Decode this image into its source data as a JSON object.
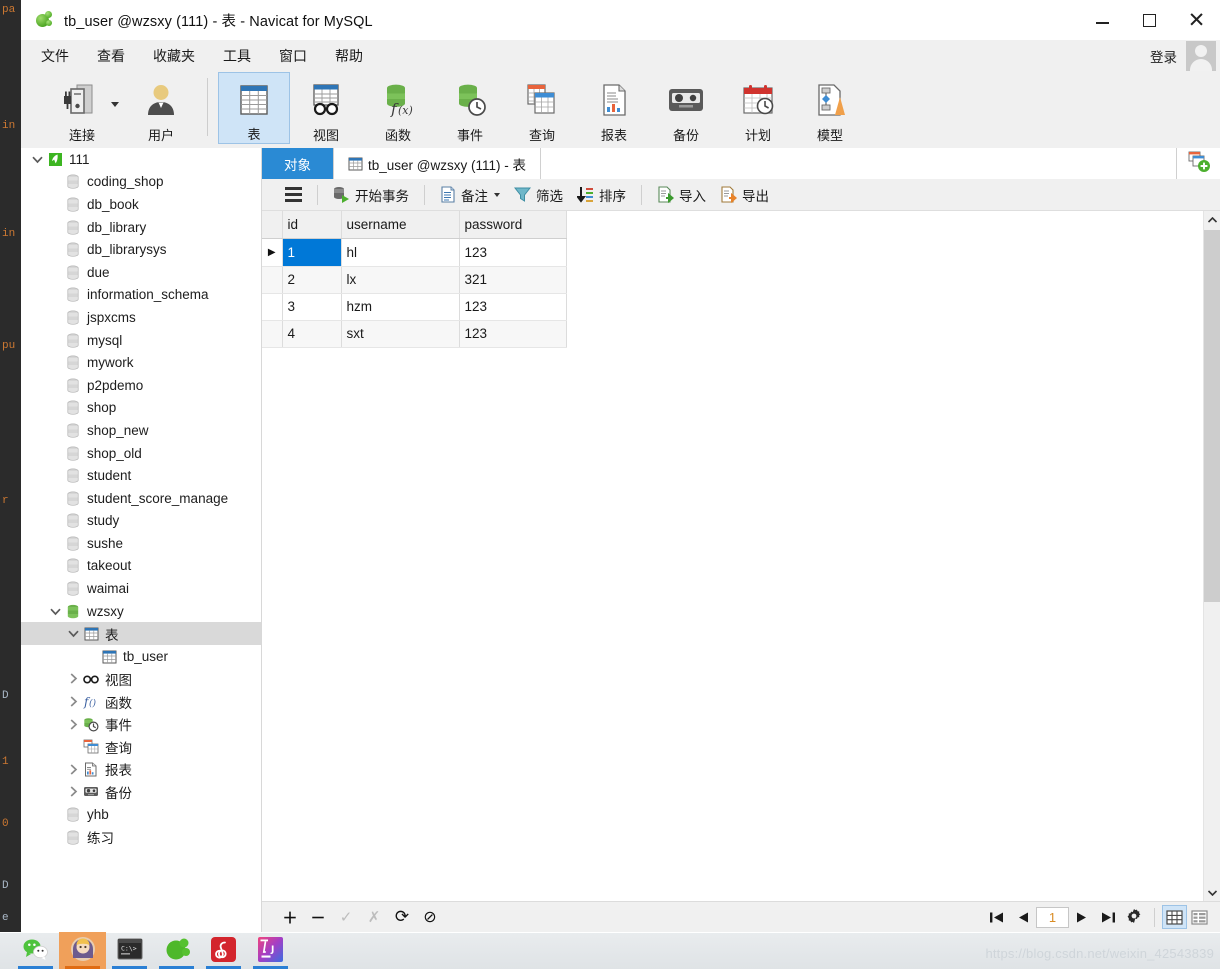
{
  "window": {
    "title": "tb_user @wzsxy (111) - 表 - Navicat for MySQL",
    "app_icon": "navicat-elephant-icon",
    "minimize_label": "",
    "maximize_label": "",
    "close_label": "✕"
  },
  "menubar": {
    "items": [
      {
        "label": "文件",
        "name": "menu-file"
      },
      {
        "label": "查看",
        "name": "menu-view"
      },
      {
        "label": "收藏夹",
        "name": "menu-favorites"
      },
      {
        "label": "工具",
        "name": "menu-tools"
      },
      {
        "label": "窗口",
        "name": "menu-window"
      },
      {
        "label": "帮助",
        "name": "menu-help"
      }
    ],
    "login_label": "登录"
  },
  "toolbar": {
    "items": [
      {
        "label": "连接",
        "icon": "connection-icon",
        "has_dropdown": true,
        "active": false
      },
      {
        "label": "用户",
        "icon": "user-icon",
        "has_dropdown": false,
        "active": false
      },
      {
        "label": "表",
        "icon": "table-icon",
        "has_dropdown": false,
        "active": true
      },
      {
        "label": "视图",
        "icon": "view-icon",
        "has_dropdown": false,
        "active": false
      },
      {
        "label": "函数",
        "icon": "function-icon",
        "has_dropdown": false,
        "active": false
      },
      {
        "label": "事件",
        "icon": "event-icon",
        "has_dropdown": false,
        "active": false
      },
      {
        "label": "查询",
        "icon": "query-icon",
        "has_dropdown": false,
        "active": false
      },
      {
        "label": "报表",
        "icon": "report-icon",
        "has_dropdown": false,
        "active": false
      },
      {
        "label": "备份",
        "icon": "backup-icon",
        "has_dropdown": false,
        "active": false
      },
      {
        "label": "计划",
        "icon": "schedule-icon",
        "has_dropdown": false,
        "active": false
      },
      {
        "label": "模型",
        "icon": "model-icon",
        "has_dropdown": false,
        "active": false
      }
    ]
  },
  "sidebar": {
    "items": [
      {
        "label": "111",
        "indent": 0,
        "icon": "connection-green-icon",
        "twisty": "down",
        "selected": false
      },
      {
        "label": "coding_shop",
        "indent": 1,
        "icon": "database-gray-icon",
        "twisty": "none",
        "selected": false
      },
      {
        "label": "db_book",
        "indent": 1,
        "icon": "database-gray-icon",
        "twisty": "none",
        "selected": false
      },
      {
        "label": "db_library",
        "indent": 1,
        "icon": "database-gray-icon",
        "twisty": "none",
        "selected": false
      },
      {
        "label": "db_librarysys",
        "indent": 1,
        "icon": "database-gray-icon",
        "twisty": "none",
        "selected": false
      },
      {
        "label": "due",
        "indent": 1,
        "icon": "database-gray-icon",
        "twisty": "none",
        "selected": false
      },
      {
        "label": "information_schema",
        "indent": 1,
        "icon": "database-gray-icon",
        "twisty": "none",
        "selected": false
      },
      {
        "label": "jspxcms",
        "indent": 1,
        "icon": "database-gray-icon",
        "twisty": "none",
        "selected": false
      },
      {
        "label": "mysql",
        "indent": 1,
        "icon": "database-gray-icon",
        "twisty": "none",
        "selected": false
      },
      {
        "label": "mywork",
        "indent": 1,
        "icon": "database-gray-icon",
        "twisty": "none",
        "selected": false
      },
      {
        "label": "p2pdemo",
        "indent": 1,
        "icon": "database-gray-icon",
        "twisty": "none",
        "selected": false
      },
      {
        "label": "shop",
        "indent": 1,
        "icon": "database-gray-icon",
        "twisty": "none",
        "selected": false
      },
      {
        "label": "shop_new",
        "indent": 1,
        "icon": "database-gray-icon",
        "twisty": "none",
        "selected": false
      },
      {
        "label": "shop_old",
        "indent": 1,
        "icon": "database-gray-icon",
        "twisty": "none",
        "selected": false
      },
      {
        "label": "student",
        "indent": 1,
        "icon": "database-gray-icon",
        "twisty": "none",
        "selected": false
      },
      {
        "label": "student_score_manage",
        "indent": 1,
        "icon": "database-gray-icon",
        "twisty": "none",
        "selected": false
      },
      {
        "label": "study",
        "indent": 1,
        "icon": "database-gray-icon",
        "twisty": "none",
        "selected": false
      },
      {
        "label": "sushe",
        "indent": 1,
        "icon": "database-gray-icon",
        "twisty": "none",
        "selected": false
      },
      {
        "label": "takeout",
        "indent": 1,
        "icon": "database-gray-icon",
        "twisty": "none",
        "selected": false
      },
      {
        "label": "waimai",
        "indent": 1,
        "icon": "database-gray-icon",
        "twisty": "none",
        "selected": false
      },
      {
        "label": "wzsxy",
        "indent": 1,
        "icon": "database-green-icon",
        "twisty": "down",
        "selected": false
      },
      {
        "label": "表",
        "indent": 2,
        "icon": "table-icon",
        "twisty": "down",
        "selected": true
      },
      {
        "label": "tb_user",
        "indent": 3,
        "icon": "table-icon",
        "twisty": "none",
        "selected": false
      },
      {
        "label": "视图",
        "indent": 2,
        "icon": "view-glasses-icon",
        "twisty": "right",
        "selected": false
      },
      {
        "label": "函数",
        "indent": 2,
        "icon": "function-fx-icon",
        "twisty": "right",
        "selected": false
      },
      {
        "label": "事件",
        "indent": 2,
        "icon": "event-clock-icon",
        "twisty": "right",
        "selected": false
      },
      {
        "label": "查询",
        "indent": 2,
        "icon": "query-icon",
        "twisty": "none",
        "selected": false
      },
      {
        "label": "报表",
        "indent": 2,
        "icon": "report-icon",
        "twisty": "right",
        "selected": false
      },
      {
        "label": "备份",
        "indent": 2,
        "icon": "backup-icon",
        "twisty": "right",
        "selected": false
      },
      {
        "label": "yhb",
        "indent": 1,
        "icon": "database-gray-icon",
        "twisty": "none",
        "selected": false
      },
      {
        "label": "练习",
        "indent": 1,
        "icon": "database-gray-icon",
        "twisty": "none",
        "selected": false
      }
    ]
  },
  "tabs": {
    "objects_label": "对象",
    "table_tab_label": "tb_user @wzsxy (111) - 表",
    "new_tab_icon": "new-query-icon"
  },
  "grid_toolbar": {
    "menu_icon": "hamburger-icon",
    "buttons": [
      {
        "label": "开始事务",
        "icon": "begin-transaction-icon",
        "name": "begin-transaction-button",
        "caret": false
      },
      {
        "label": "备注",
        "icon": "note-icon",
        "name": "note-button",
        "caret": true
      },
      {
        "label": "筛选",
        "icon": "filter-icon",
        "name": "filter-button",
        "caret": false
      },
      {
        "label": "排序",
        "icon": "sort-icon",
        "name": "sort-button",
        "caret": false
      },
      {
        "label": "导入",
        "icon": "import-icon",
        "name": "import-button",
        "caret": false
      },
      {
        "label": "导出",
        "icon": "export-icon",
        "name": "export-button",
        "caret": false
      }
    ]
  },
  "grid": {
    "columns": [
      "id",
      "username",
      "password"
    ],
    "rows": [
      {
        "id": "1",
        "username": "hl",
        "password": "123"
      },
      {
        "id": "2",
        "username": "lx",
        "password": "321"
      },
      {
        "id": "3",
        "username": "hzm",
        "password": "123"
      },
      {
        "id": "4",
        "username": "sxt",
        "password": "123"
      }
    ],
    "selected_row_index": 0,
    "active_column": "id",
    "selection_color": "#0078d7"
  },
  "statusbar": {
    "left_buttons": [
      {
        "glyph": "＋",
        "name": "add-record-button",
        "dim": false
      },
      {
        "glyph": "－",
        "name": "delete-record-button",
        "dim": false
      },
      {
        "glyph": "✓",
        "name": "apply-change-button",
        "dim": true
      },
      {
        "glyph": "✗",
        "name": "discard-change-button",
        "dim": true
      },
      {
        "glyph": "⟳",
        "name": "refresh-button",
        "dim": false
      },
      {
        "glyph": "⊘",
        "name": "stop-button",
        "dim": false
      }
    ],
    "page_value": "1",
    "nav": [
      {
        "glyph": "first",
        "name": "first-record-button"
      },
      {
        "glyph": "prev",
        "name": "previous-record-button"
      },
      {
        "glyph": "next",
        "name": "next-record-button"
      },
      {
        "glyph": "last",
        "name": "last-record-button"
      }
    ],
    "settings_icon": "gear-icon",
    "views": [
      {
        "name": "grid-view-button",
        "selected": true
      },
      {
        "name": "form-view-button",
        "selected": false
      }
    ]
  },
  "taskbar": {
    "items": [
      {
        "name": "taskbar-wechat",
        "icon": "wechat-icon"
      },
      {
        "name": "taskbar-app-avatar",
        "icon": "avatar-icon"
      },
      {
        "name": "taskbar-terminal",
        "icon": "terminal-icon"
      },
      {
        "name": "taskbar-navicat",
        "icon": "navicat-icon"
      },
      {
        "name": "taskbar-netease-music",
        "icon": "netease-music-icon"
      },
      {
        "name": "taskbar-intellij",
        "icon": "intellij-idea-icon"
      }
    ]
  },
  "watermark": "https://blog.csdn.net/weixin_42543839"
}
